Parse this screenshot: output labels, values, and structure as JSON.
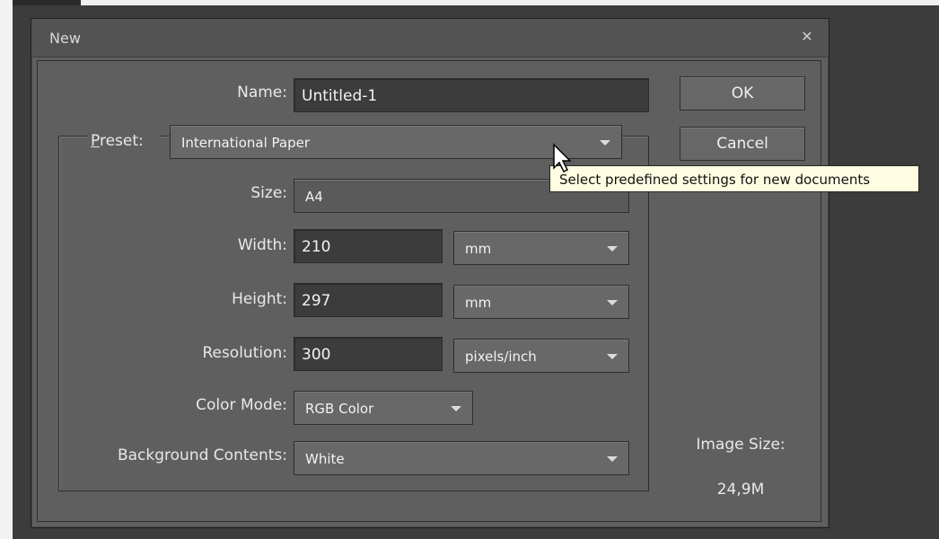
{
  "dialog": {
    "title": "New",
    "close_icon": "close-icon"
  },
  "fields": {
    "name_label": "Name:",
    "name_value": "Untitled-1",
    "preset_label_mnemonic": "P",
    "preset_label_rest": "reset:",
    "preset_value": "International Paper",
    "size_label": "Size:",
    "size_value": "A4",
    "width_label": "Width:",
    "width_value": "210",
    "width_unit": "mm",
    "height_label": "Height:",
    "height_value": "297",
    "height_unit": "mm",
    "resolution_label": "Resolution:",
    "resolution_value": "300",
    "resolution_unit": "pixels/inch",
    "color_mode_label": "Color Mode:",
    "color_mode_value": "RGB Color",
    "background_label": "Background Contents:",
    "background_value": "White"
  },
  "buttons": {
    "ok": "OK",
    "cancel": "Cancel"
  },
  "info": {
    "image_size_label": "Image Size:",
    "image_size_value": "24,9M"
  },
  "tooltip": {
    "text": "Select predefined settings for new documents"
  },
  "colors": {
    "dialog_bg": "#5f5f5f",
    "field_bg": "#3c3c3c",
    "tooltip_bg": "#fffde1"
  }
}
